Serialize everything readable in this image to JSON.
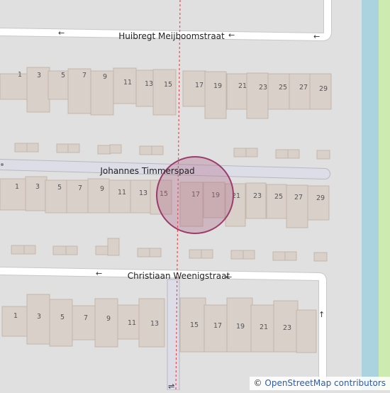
{
  "map": {
    "streets": {
      "north": "Huibregt Meijboomstraat",
      "footpath": "Johannes Timmerspad",
      "south": "Christiaan Weenigstraat"
    },
    "house_numbers": {
      "row1": [
        "1",
        "3",
        "5",
        "7",
        "9",
        "11",
        "13",
        "15",
        "17",
        "19",
        "21",
        "23",
        "25",
        "27",
        "29"
      ],
      "row2": [
        "1",
        "3",
        "5",
        "7",
        "9",
        "11",
        "13",
        "15",
        "17",
        "19",
        "21",
        "23",
        "25",
        "27",
        "29"
      ],
      "row3": [
        "1",
        "3",
        "5",
        "7",
        "9",
        "11",
        "13",
        "15",
        "17",
        "19",
        "21",
        "23"
      ]
    },
    "colors": {
      "background": "#e0e0e0",
      "building": "#d9d0c9",
      "building_outline": "#c4b6ab",
      "road": "#ffffff",
      "road_casing": "#c8c8c8",
      "footpath": "#dddde8",
      "water": "#aad3df",
      "grass": "#cdebb0",
      "highlight": "#b06a8a",
      "boundary": "#e05050"
    }
  },
  "attribution": {
    "symbol": "©",
    "text": "OpenStreetMap contributors"
  }
}
